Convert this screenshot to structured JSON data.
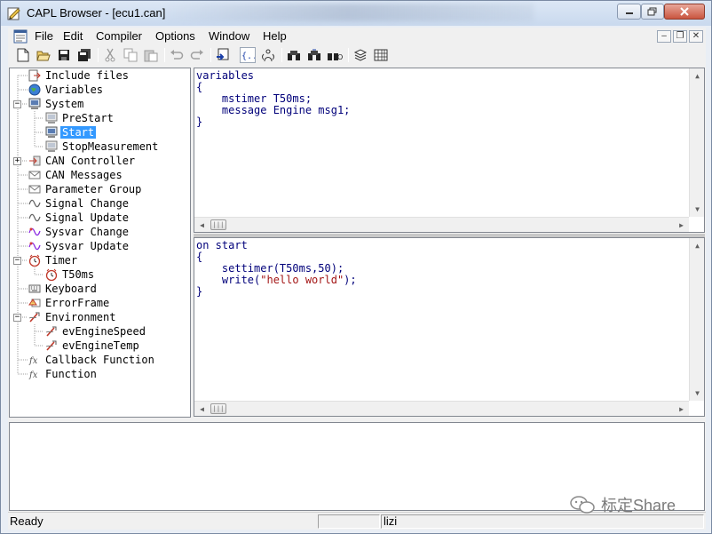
{
  "window": {
    "title": "CAPL Browser - [ecu1.can]"
  },
  "menu": {
    "items": [
      "File",
      "Edit",
      "Compiler",
      "Options",
      "Window",
      "Help"
    ]
  },
  "toolbar": {
    "buttons": [
      "new-file-icon",
      "open-folder-icon",
      "save-icon",
      "save-all-icon",
      "cut-icon",
      "copy-icon",
      "paste-icon",
      "undo-icon",
      "redo-icon",
      "compile-icon",
      "code-view-icon",
      "event-icon",
      "find-icon",
      "find-next-icon",
      "find-prev-icon",
      "stack-icon",
      "calculator-icon"
    ]
  },
  "tree": {
    "items": [
      {
        "label": "Include files",
        "icon": "include-files-icon"
      },
      {
        "label": "Variables",
        "icon": "globe-icon"
      },
      {
        "label": "System",
        "icon": "computer-icon"
      },
      {
        "label": "PreStart",
        "icon": "computer-icon"
      },
      {
        "label": "Start",
        "icon": "computer-icon"
      },
      {
        "label": "StopMeasurement",
        "icon": "computer-icon"
      },
      {
        "label": "CAN Controller",
        "icon": "can-controller-icon"
      },
      {
        "label": "CAN Messages",
        "icon": "envelope-icon"
      },
      {
        "label": "Parameter Group",
        "icon": "envelope-icon"
      },
      {
        "label": "Signal Change",
        "icon": "wave-icon"
      },
      {
        "label": "Signal Update",
        "icon": "wave-icon"
      },
      {
        "label": "Sysvar Change",
        "icon": "sysvar-wave-icon"
      },
      {
        "label": "Sysvar Update",
        "icon": "sysvar-wave-icon"
      },
      {
        "label": "Timer",
        "icon": "clock-icon"
      },
      {
        "label": "T50ms",
        "icon": "clock-icon"
      },
      {
        "label": "Keyboard",
        "icon": "keyboard-icon"
      },
      {
        "label": "ErrorFrame",
        "icon": "error-frame-icon"
      },
      {
        "label": "Environment",
        "icon": "env-icon"
      },
      {
        "label": "evEngineSpeed",
        "icon": "env-icon"
      },
      {
        "label": "evEngineTemp",
        "icon": "env-icon"
      },
      {
        "label": "Callback Function",
        "icon": "function-icon"
      },
      {
        "label": "Function",
        "icon": "function-icon"
      }
    ],
    "selected": "Start"
  },
  "editor_top": {
    "lines": [
      "variables",
      "{",
      "    mstimer T50ms;",
      "    message Engine msg1;",
      "}"
    ]
  },
  "editor_bottom": {
    "line1": "on start",
    "line2": "{",
    "line3": "    settimer(T50ms,50);",
    "line4_prefix": "    write(",
    "line4_string": "\"hello world\"",
    "line4_suffix": ");",
    "line5": "}"
  },
  "statusbar": {
    "status": "Ready",
    "user": "lizi"
  },
  "watermark": {
    "text": "标定Share"
  },
  "colors": {
    "code": "#00007a",
    "string": "#a31515",
    "selection": "#3399ff"
  }
}
